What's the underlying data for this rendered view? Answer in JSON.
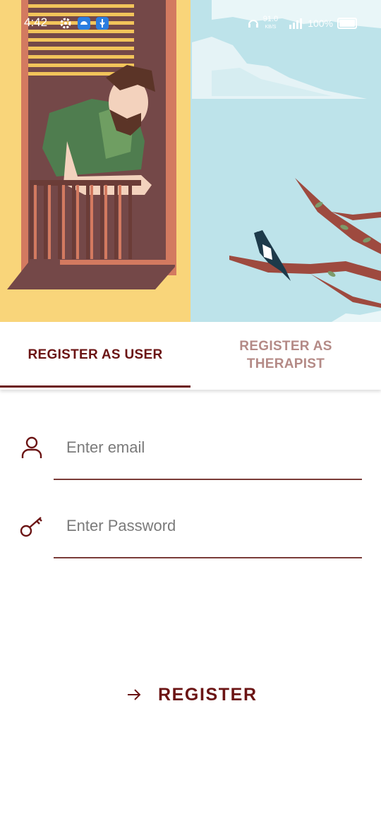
{
  "status_bar": {
    "time": "4:42",
    "speed": "91.0",
    "speed_unit": "KB/S",
    "battery": "100%"
  },
  "tabs": [
    {
      "label": "REGISTER AS USER",
      "selected": true
    },
    {
      "label": "REGISTER AS THERAPIST",
      "selected": false
    }
  ],
  "form": {
    "email_placeholder": "Enter email",
    "password_placeholder": "Enter Password",
    "register_label": "REGISTER"
  },
  "colors": {
    "accent": "#6b1414",
    "inactive_tab": "#b48a86",
    "underline": "#7a3b38"
  },
  "icons": [
    "settings-icon",
    "android-icon",
    "usb-icon",
    "headset-icon",
    "signal-icon",
    "battery-icon",
    "person-icon",
    "key-icon",
    "arrow-right-icon"
  ]
}
